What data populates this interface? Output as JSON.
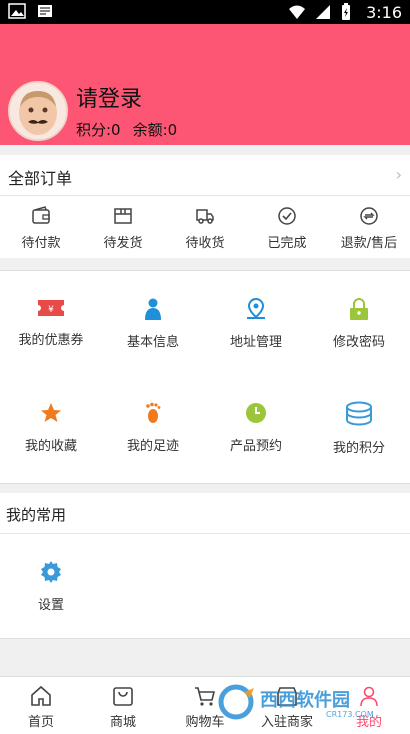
{
  "status_bar": {
    "time": "3:16"
  },
  "profile": {
    "login_text": "请登录",
    "points_label": "积分:0",
    "balance_label": "余额:0"
  },
  "orders": {
    "title": "全部订单",
    "chevron": "›",
    "items": [
      {
        "label": "待付款",
        "icon": "wallet-icon"
      },
      {
        "label": "待发货",
        "icon": "package-icon"
      },
      {
        "label": "待收货",
        "icon": "truck-icon"
      },
      {
        "label": "已完成",
        "icon": "check-circle-icon"
      },
      {
        "label": "退款/售后",
        "icon": "refund-icon"
      }
    ]
  },
  "grid": {
    "items": [
      {
        "label": "我的优惠券",
        "icon": "coupon-icon",
        "color": "#e84a4a"
      },
      {
        "label": "基本信息",
        "icon": "person-icon",
        "color": "#1e8fd8"
      },
      {
        "label": "地址管理",
        "icon": "location-icon",
        "color": "#1e8fd8"
      },
      {
        "label": "修改密码",
        "icon": "lock-icon",
        "color": "#9bc63b"
      },
      {
        "label": "我的收藏",
        "icon": "star-icon",
        "color": "#f07a1e"
      },
      {
        "label": "我的足迹",
        "icon": "footprint-icon",
        "color": "#f07a1e"
      },
      {
        "label": "产品预约",
        "icon": "clock-icon",
        "color": "#9bc63b"
      },
      {
        "label": "我的积分",
        "icon": "coins-icon",
        "color": "#3a9ad9"
      }
    ]
  },
  "common": {
    "title": "我的常用",
    "items": [
      {
        "label": "设置",
        "icon": "gear-icon",
        "color": "#3a9ad9"
      }
    ]
  },
  "tabbar": {
    "items": [
      {
        "label": "首页",
        "icon": "home-icon"
      },
      {
        "label": "商城",
        "icon": "bag-icon"
      },
      {
        "label": "购物车",
        "icon": "cart-icon"
      },
      {
        "label": "入驻商家",
        "icon": "store-icon"
      },
      {
        "label": "我的",
        "icon": "user-icon"
      }
    ]
  },
  "colors": {
    "header_bg": "#fd5674",
    "active_tab": "#ff4a6d"
  },
  "watermark": {
    "text": "西西软件园",
    "sub": "CR173.COM"
  }
}
